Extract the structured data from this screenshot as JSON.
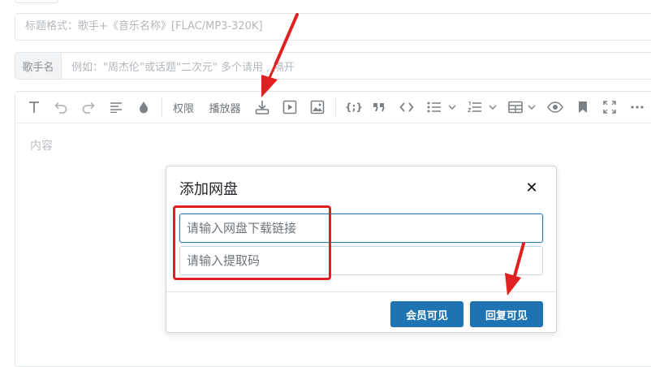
{
  "form": {
    "title_placeholder": "标题格式：歌手+《音乐名称》[FLAC/MP3-320K]",
    "singer_label": "歌手名",
    "singer_placeholder": "例如：\"周杰伦\"或话题\"二次元\" 多个请用 , 隔开"
  },
  "toolbar": {
    "permission_label": "权限",
    "player_label": "播放器",
    "code_label": "{;}",
    "icons": [
      "text-icon",
      "undo-icon",
      "redo-icon",
      "align-icon",
      "color-drop-icon",
      "download-icon",
      "video-play-icon",
      "image-icon",
      "code-block-icon",
      "quote-icon",
      "inline-code-icon",
      "bullet-list-icon",
      "chevron-down-icon",
      "numbered-list-icon",
      "chevron-down-icon",
      "table-icon",
      "chevron-down-icon",
      "preview-eye-icon",
      "bookmark-icon",
      "fullscreen-icon",
      "more-icon"
    ]
  },
  "editor": {
    "content_placeholder": "内容"
  },
  "modal": {
    "title": "添加网盘",
    "close_symbol": "✕",
    "link_placeholder": "请输入网盘下载链接",
    "code_placeholder": "请输入提取码",
    "member_button": "会员可见",
    "reply_button": "回复可见"
  },
  "colors": {
    "primary_button": "#1e73b3",
    "annotation_red": "#e02020",
    "focus_border": "#2f7bb0"
  }
}
